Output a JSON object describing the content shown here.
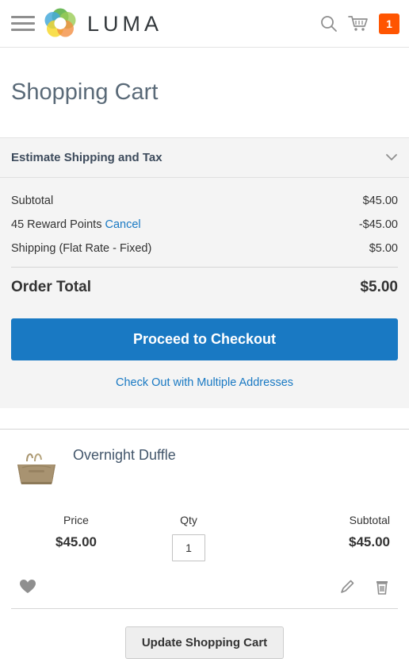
{
  "header": {
    "menu_icon": "hamburger-menu-icon",
    "brand": "LUMA",
    "logo_icon": "luma-flower-logo",
    "search_icon": "search-icon",
    "cart_icon": "shopping-cart-icon",
    "cart_count": "1",
    "badge_color": "#ff5501"
  },
  "page": {
    "title": "Shopping Cart"
  },
  "summary": {
    "estimate": {
      "title": "Estimate Shipping and Tax",
      "toggle_icon": "chevron-down-icon"
    },
    "lines": [
      {
        "label": "Subtotal",
        "value": "$45.00",
        "link": null
      },
      {
        "label": "45 Reward Points",
        "value": "-$45.00",
        "link": "Cancel"
      },
      {
        "label": "Shipping (Flat Rate - Fixed)",
        "value": "$5.00",
        "link": null
      }
    ],
    "order_total": {
      "label": "Order Total",
      "value": "$5.00"
    },
    "checkout_button": "Proceed to Checkout",
    "checkout_button_color": "#1979c3",
    "multi_address_link": "Check Out with Multiple Addresses"
  },
  "cart_items": [
    {
      "name": "Overnight Duffle",
      "thumb_icon": "product-thumbnail-duffle-bag",
      "price_label": "Price",
      "price_value": "$45.00",
      "qty_label": "Qty",
      "qty_value": "1",
      "subtotal_label": "Subtotal",
      "subtotal_value": "$45.00",
      "wishlist_icon": "heart-icon",
      "edit_icon": "pencil-edit-icon",
      "remove_icon": "trash-delete-icon"
    }
  ],
  "footer": {
    "update_button": "Update Shopping Cart"
  }
}
